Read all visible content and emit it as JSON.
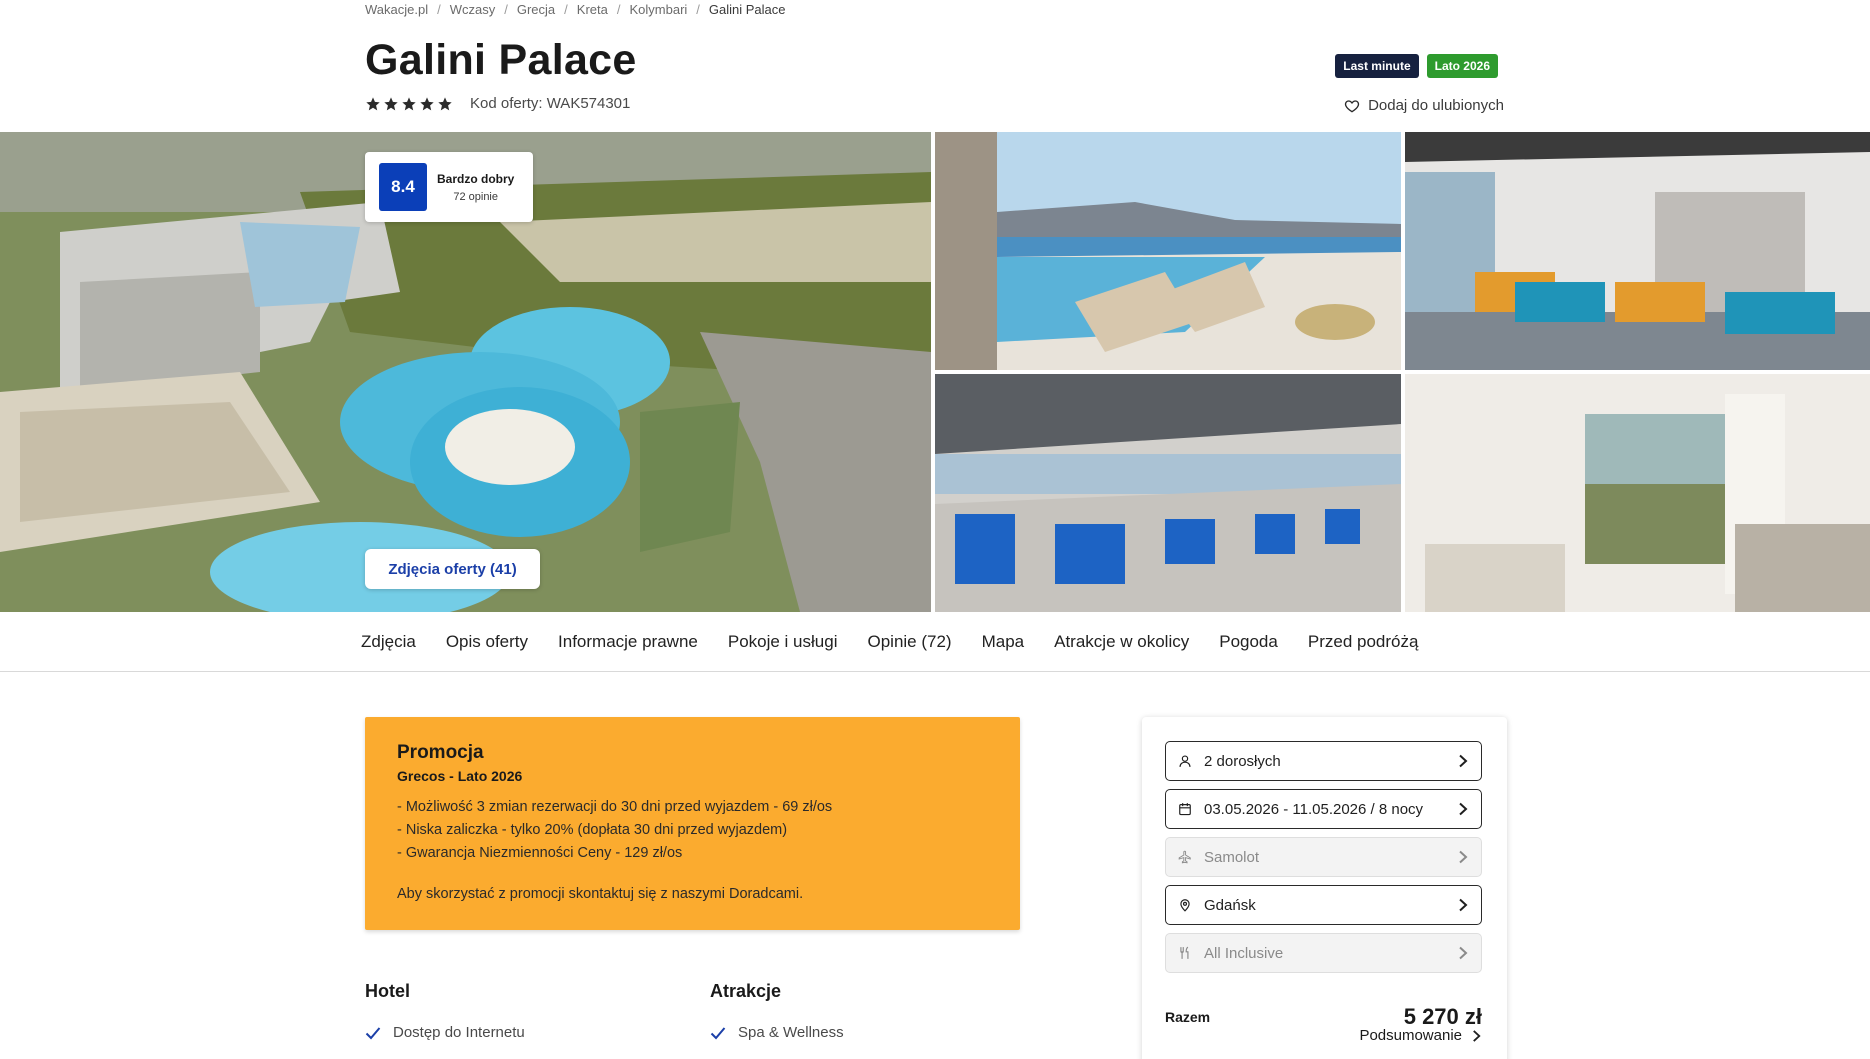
{
  "breadcrumb": [
    "Wakacje.pl",
    "Wczasy",
    "Grecja",
    "Kreta",
    "Kolymbari",
    "Galini Palace"
  ],
  "title": "Galini Palace",
  "stars": 5,
  "offer_code": "Kod oferty: WAK574301",
  "badges": {
    "last_minute": "Last minute",
    "lato": "Lato 2026"
  },
  "badge_colors": {
    "last_minute": "#16213f",
    "lato": "#2e9b2e"
  },
  "favorite_label": "Dodaj do ulubionych",
  "rating": {
    "score": "8.4",
    "label": "Bardzo dobry",
    "count": "72 opinie"
  },
  "photos_button": "Zdjęcia oferty (41)",
  "tabs": [
    "Zdjęcia",
    "Opis oferty",
    "Informacje prawne",
    "Pokoje i usługi",
    "Opinie (72)",
    "Mapa",
    "Atrakcje w okolicy",
    "Pogoda",
    "Przed podróżą"
  ],
  "promo": {
    "title": "Promocja",
    "subtitle": "Grecos - Lato 2026",
    "lines": [
      "- Możliwość 3 zmian rezerwacji do 30 dni przed wyjazdem - 69 zł/os",
      "- Niska zaliczka - tylko 20% (dopłata 30 dni przed wyjazdem)",
      "- Gwarancja Niezmienności Ceny - 129 zł/os"
    ],
    "note": "Aby skorzystać z promocji skontaktuj się z naszymi Doradcami.",
    "color": "#fbab2f"
  },
  "features": {
    "hotel": {
      "heading": "Hotel",
      "first_item": "Dostęp do Internetu"
    },
    "atrakcje": {
      "heading": "Atrakcje",
      "first_item": "Spa & Wellness"
    }
  },
  "booking": {
    "travelers": "2 dorosłych",
    "dates": "03.05.2026 - 11.05.2026 / 8 nocy",
    "transport": "Samolot",
    "departure": "Gdańsk",
    "board": "All Inclusive",
    "total_label": "Razem",
    "total_price": "5 270 zł",
    "summary_label": "Podsumowanie"
  },
  "icons": [
    "star-icon",
    "heart-icon",
    "user-icon",
    "calendar-icon",
    "plane-icon",
    "location-pin-icon",
    "cutlery-icon",
    "chevron-right-icon",
    "check-icon"
  ]
}
